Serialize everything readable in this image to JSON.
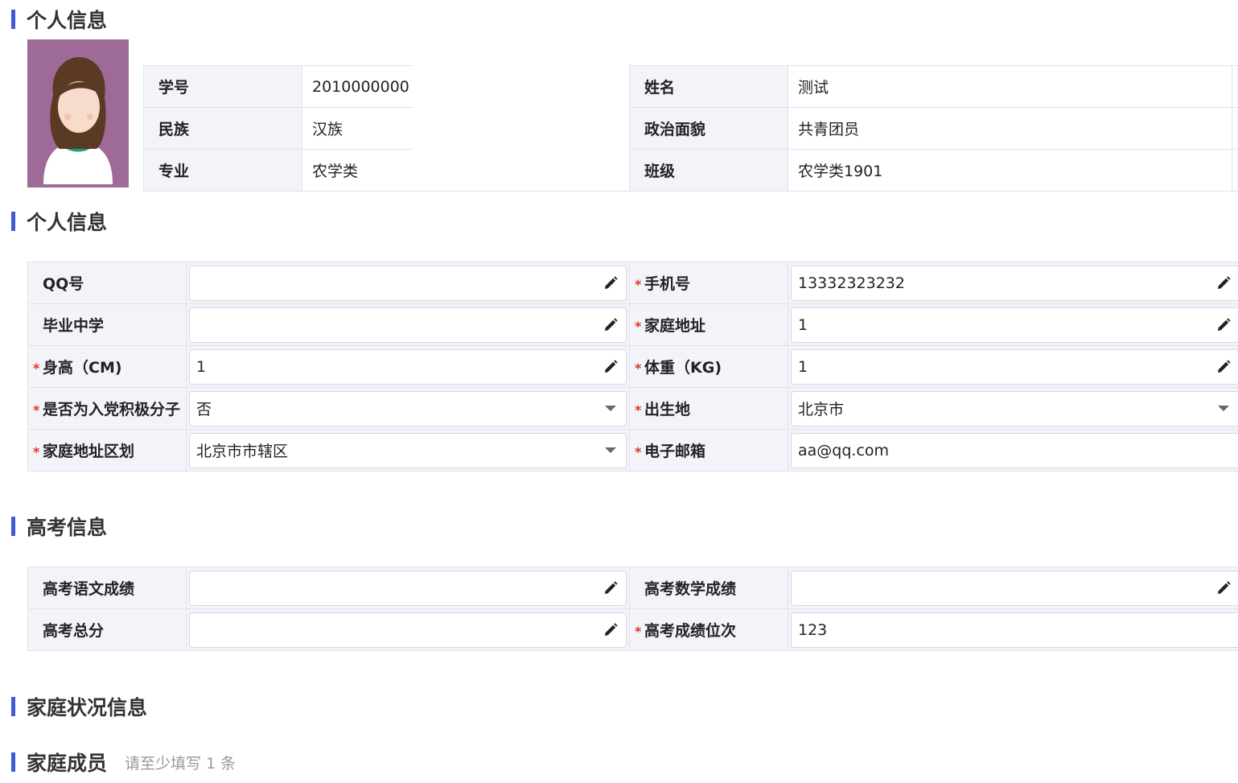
{
  "sections": {
    "personal1": "个人信息",
    "personal2": "个人信息",
    "gaokao": "高考信息",
    "family": "家庭状况信息",
    "members": "家庭成员",
    "members_hint": "请至少填写 1 条"
  },
  "profile": {
    "student_id_label": "学号",
    "student_id": "2010000000",
    "name_label": "姓名",
    "name": "测试",
    "ethnicity_label": "民族",
    "ethnicity": "汉族",
    "political_label": "政治面貌",
    "political": "共青团员",
    "major_label": "专业",
    "major": "农学类",
    "class_label": "班级",
    "class": "农学类1901"
  },
  "personal_form": {
    "qq_label": "QQ号",
    "qq": "",
    "phone_label": "手机号",
    "phone": "13332323232",
    "school_label": "毕业中学",
    "school": "",
    "address_label": "家庭地址",
    "address": "1",
    "height_label": "身高（CM)",
    "height": "1",
    "weight_label": "体重（KG)",
    "weight": "1",
    "party_label": "是否为入党积极分子",
    "party": "否",
    "birthplace_label": "出生地",
    "birthplace": "北京市",
    "region_label": "家庭地址区划",
    "region": "北京市市辖区",
    "email_label": "电子邮箱",
    "email": "aa@qq.com"
  },
  "gaokao_form": {
    "chinese_label": "高考语文成绩",
    "chinese": "",
    "math_label": "高考数学成绩",
    "math": "",
    "total_label": "高考总分",
    "total": "",
    "rank_label": "高考成绩位次",
    "rank": "123"
  },
  "required_mark": "*",
  "colors": {
    "accent": "#3d5bd9",
    "required": "#e0322f",
    "label_bg": "#f3f4f9",
    "avatar_bg": "#9e6b98"
  },
  "icons": {
    "edit": "pencil-icon",
    "dropdown": "caret-down-icon"
  }
}
